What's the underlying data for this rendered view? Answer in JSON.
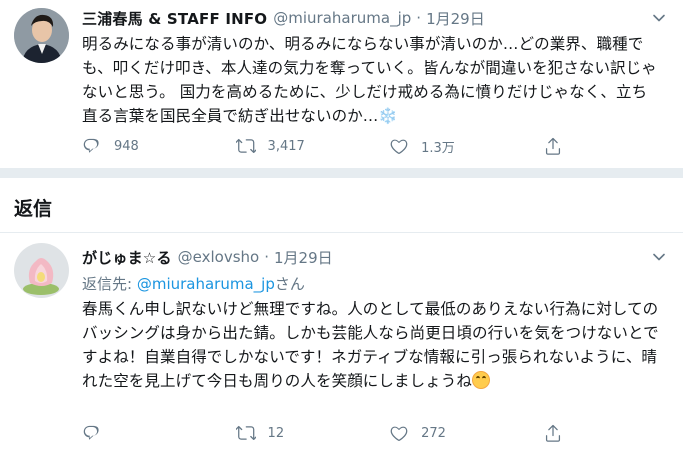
{
  "main_tweet": {
    "name": "三浦春馬 & STAFF INFO",
    "handle": "@miuraharuma_jp",
    "separator": "·",
    "date": "1月29日",
    "text": "明るみになる事が清いのか、明るみにならない事が清いのか…どの業界、職種でも、叩くだけ叩き、本人達の気力を奪っていく。皆んなが間違いを犯さない訳じゃないと思う。  国力を高めるために、少しだけ戒める為に憤りだけじゃなく、立ち直る言葉を国民全員で紡ぎ出せないのか…",
    "emoji": "❄️",
    "counts": {
      "reply": "948",
      "retweet": "3,417",
      "like": "1.3万"
    }
  },
  "section": {
    "title": "返信"
  },
  "reply_tweet": {
    "name": "がじゅま☆る",
    "handle": "@exlovsho",
    "separator": "·",
    "date": "1月29日",
    "reply_to_prefix": "返信先: ",
    "reply_to_mention": "@miuraharuma_jp",
    "reply_to_suffix": "さん",
    "text": "春馬くん申し訳ないけど無理ですね。人のとして最低のありえない行為に対してのバッシングは身から出た錆。しかも芸能人なら尚更日頃の行いを気をつけないとですよね！自業自得でしかないです！ネガティブな情報に引っ張られないように、晴れた空を見上げて今日も周りの人を笑顔にしましょうね",
    "counts": {
      "reply": "",
      "retweet": "12",
      "like": "272"
    }
  },
  "icons": {
    "reply": "reply-icon",
    "retweet": "retweet-icon",
    "like": "heart-icon",
    "share": "share-icon",
    "more": "chevron-down-icon"
  },
  "colors": {
    "text": "#14171a",
    "secondary": "#657786",
    "link": "#1b95e0",
    "divider": "#e6ecf0"
  }
}
